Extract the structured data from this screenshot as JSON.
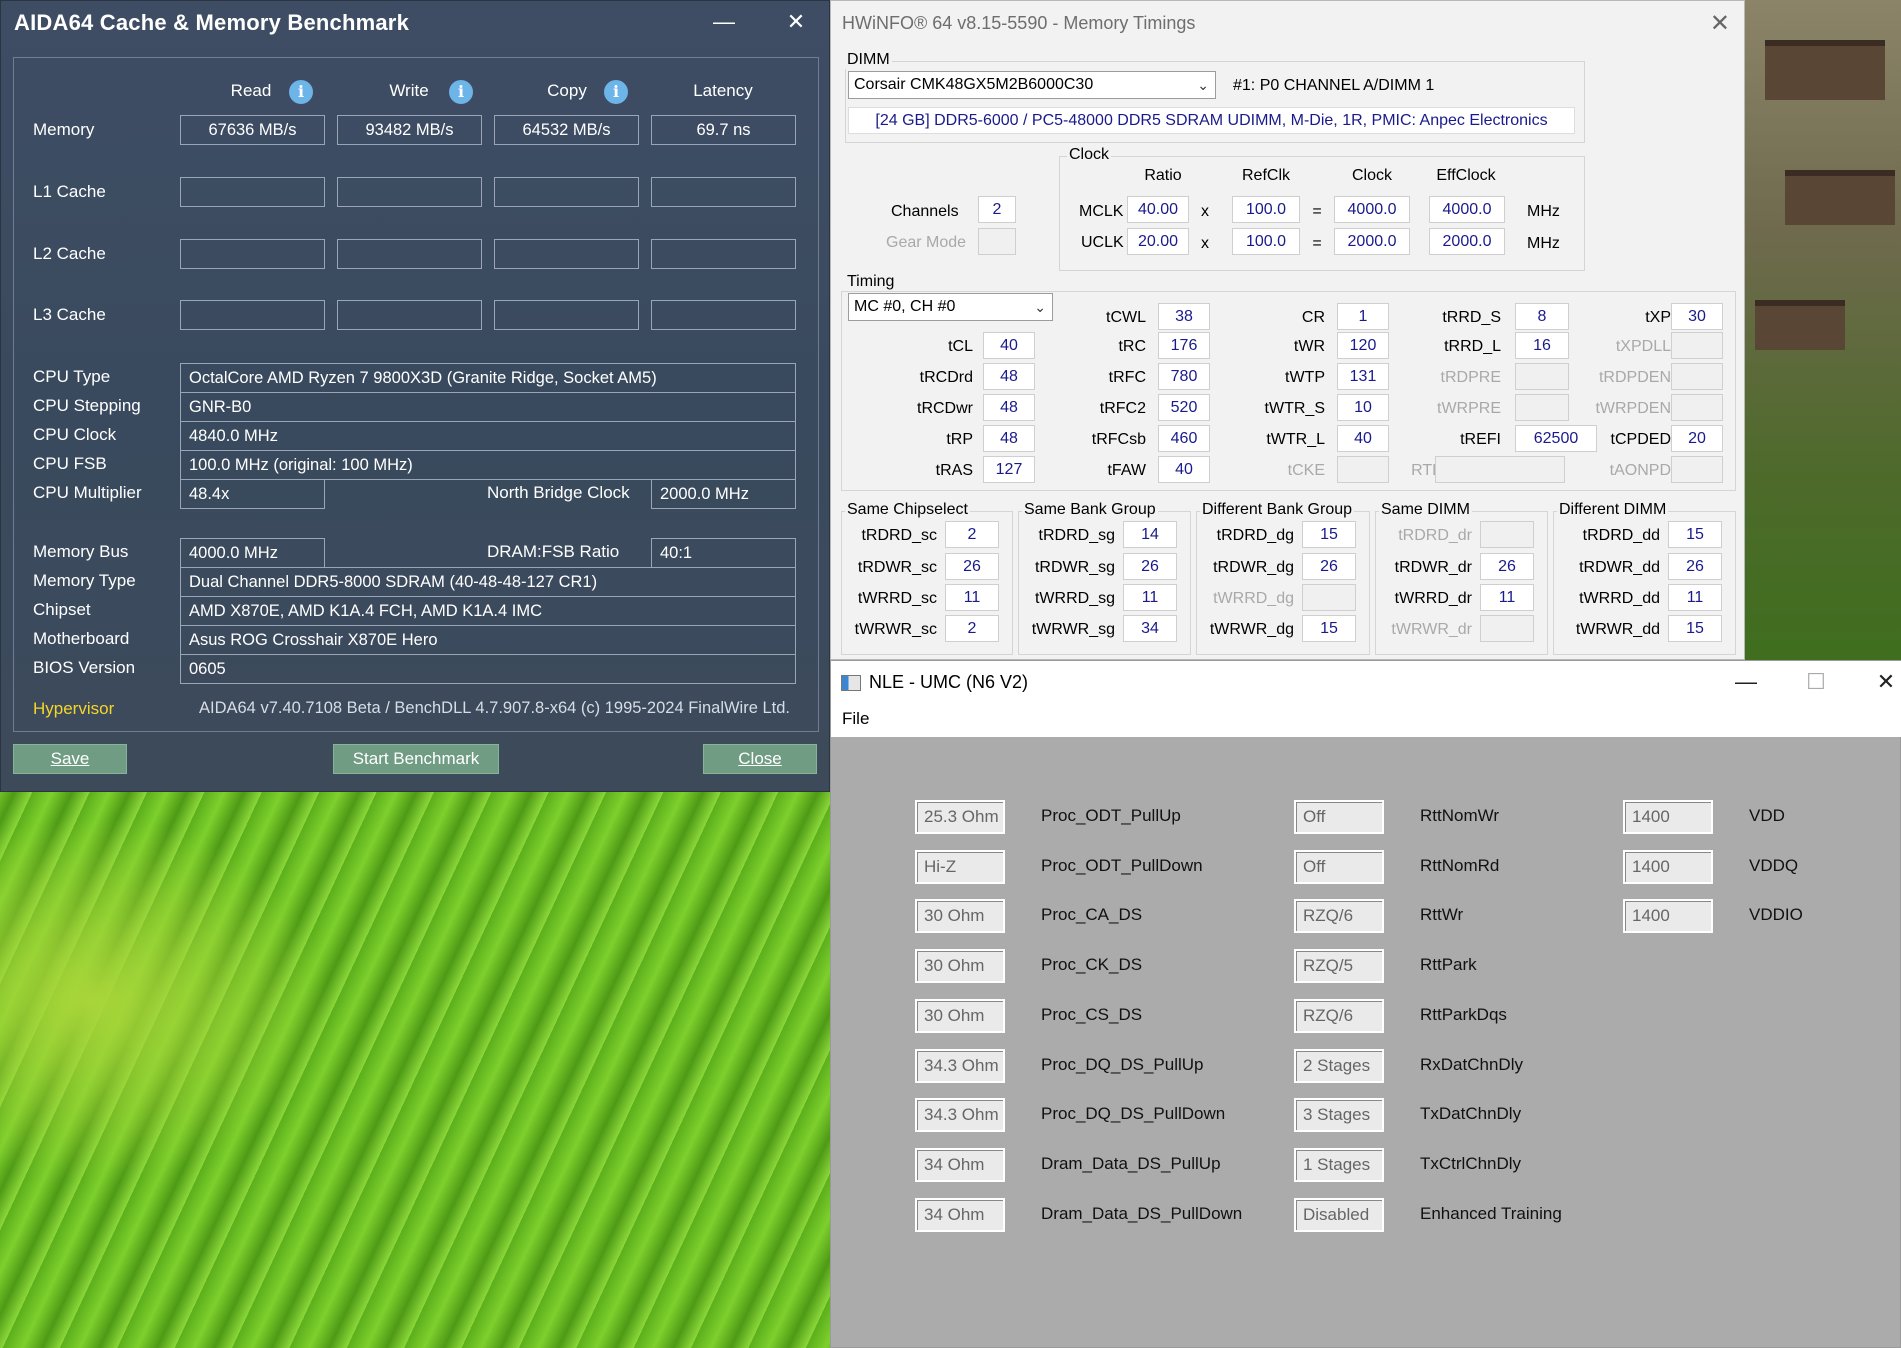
{
  "aida": {
    "title": "AIDA64 Cache & Memory Benchmark",
    "minimize": "—",
    "close_glyph": "✕",
    "headers": [
      "Read",
      "Write",
      "Copy",
      "Latency"
    ],
    "info_glyph": "i",
    "rows": [
      {
        "label": "Memory",
        "values": [
          "67636 MB/s",
          "93482 MB/s",
          "64532 MB/s",
          "69.7 ns"
        ]
      },
      {
        "label": "L1 Cache",
        "values": [
          "",
          "",
          "",
          ""
        ]
      },
      {
        "label": "L2 Cache",
        "values": [
          "",
          "",
          "",
          ""
        ]
      },
      {
        "label": "L3 Cache",
        "values": [
          "",
          "",
          "",
          ""
        ]
      }
    ],
    "cpu_type_label": "CPU Type",
    "cpu_type": "OctalCore AMD Ryzen 7 9800X3D  (Granite Ridge, Socket AM5)",
    "cpu_stepping_label": "CPU Stepping",
    "cpu_stepping": "GNR-B0",
    "cpu_clock_label": "CPU Clock",
    "cpu_clock": "4840.0 MHz",
    "cpu_fsb_label": "CPU FSB",
    "cpu_fsb": "100.0 MHz  (original: 100 MHz)",
    "cpu_multiplier_label": "CPU Multiplier",
    "cpu_multiplier": "48.4x",
    "nb_clock_label": "North Bridge Clock",
    "nb_clock": "2000.0 MHz",
    "memory_bus_label": "Memory Bus",
    "memory_bus": "4000.0 MHz",
    "dram_fsb_label": "DRAM:FSB Ratio",
    "dram_fsb": "40:1",
    "memory_type_label": "Memory Type",
    "memory_type": "Dual Channel DDR5-8000 SDRAM  (40-48-48-127 CR1)",
    "chipset_label": "Chipset",
    "chipset": "AMD X870E, AMD K1A.4 FCH, AMD K1A.4 IMC",
    "motherboard_label": "Motherboard",
    "motherboard": "Asus ROG Crosshair X870E Hero",
    "bios_label": "BIOS Version",
    "bios": "0605",
    "hypervisor": "Hypervisor",
    "footer": "AIDA64 v7.40.7108 Beta / BenchDLL 4.7.907.8-x64  (c) 1995-2024 FinalWire Ltd.",
    "save": "Save",
    "start": "Start Benchmark",
    "close": "Close"
  },
  "hwinfo": {
    "title": "HWiNFO® 64 v8.15-5590 - Memory Timings",
    "close_glyph": "✕",
    "dimm_group": "DIMM",
    "dimm_select": "Corsair CMK48GX5M2B6000C30",
    "dimm_slot": "#1: P0 CHANNEL A/DIMM 1",
    "dimm_desc": "[24 GB] DDR5-6000 / PC5-48000 DDR5 SDRAM UDIMM, M-Die, 1R, PMIC: Anpec Electronics",
    "clock_group": "Clock",
    "clock_headers": [
      "Ratio",
      "RefClk",
      "Clock",
      "EffClock"
    ],
    "channels_label": "Channels",
    "channels": "2",
    "gear_label": "Gear Mode",
    "gear": "",
    "mclk": {
      "label": "MCLK",
      "ratio": "40.00",
      "refclk": "100.0",
      "clock": "4000.0",
      "eff": "4000.0"
    },
    "uclk": {
      "label": "UCLK",
      "ratio": "20.00",
      "refclk": "100.0",
      "clock": "2000.0",
      "eff": "2000.0"
    },
    "op_x": "x",
    "op_eq": "=",
    "unit": "MHz",
    "timing_group": "Timing",
    "timing_select": "MC #0, CH #0",
    "timings": {
      "tCL": "40",
      "tRCDrd": "48",
      "tRCDwr": "48",
      "tRP": "48",
      "tRAS": "127",
      "tCWL": "38",
      "tRC": "176",
      "tRFC": "780",
      "tRFC2": "520",
      "tRFCsb": "460",
      "tFAW": "40",
      "CR": "1",
      "tWR": "120",
      "tWTP": "131",
      "tWTR_S": "10",
      "tWTR_L": "40",
      "tCKE": "",
      "tRRD_S": "8",
      "tRRD_L": "16",
      "tRDPRE": "",
      "tWRPRE": "",
      "tREFI": "62500",
      "RTL": "",
      "tXP": "30",
      "tXPDLL": "",
      "tRDPDEN": "",
      "tWRPDEN": "",
      "tCPDED": "20",
      "tAONPD": ""
    },
    "groups": [
      {
        "title": "Same Chipselect",
        "rows": [
          [
            "tRDRD_sc",
            "2",
            false
          ],
          [
            "tRDWR_sc",
            "26",
            false
          ],
          [
            "tWRRD_sc",
            "11",
            false
          ],
          [
            "tWRWR_sc",
            "2",
            false
          ]
        ]
      },
      {
        "title": "Same Bank Group",
        "rows": [
          [
            "tRDRD_sg",
            "14",
            false
          ],
          [
            "tRDWR_sg",
            "26",
            false
          ],
          [
            "tWRRD_sg",
            "11",
            false
          ],
          [
            "tWRWR_sg",
            "34",
            false
          ]
        ]
      },
      {
        "title": "Different Bank Group",
        "rows": [
          [
            "tRDRD_dg",
            "15",
            false
          ],
          [
            "tRDWR_dg",
            "26",
            false
          ],
          [
            "tWRRD_dg",
            "",
            true
          ],
          [
            "tWRWR_dg",
            "15",
            false
          ]
        ]
      },
      {
        "title": "Same DIMM",
        "rows": [
          [
            "tRDRD_dr",
            "",
            true
          ],
          [
            "tRDWR_dr",
            "26",
            false
          ],
          [
            "tWRRD_dr",
            "11",
            false
          ],
          [
            "tWRWR_dr",
            "",
            true
          ]
        ]
      },
      {
        "title": "Different DIMM",
        "rows": [
          [
            "tRDRD_dd",
            "15",
            false
          ],
          [
            "tRDWR_dd",
            "26",
            false
          ],
          [
            "tWRRD_dd",
            "11",
            false
          ],
          [
            "tWRWR_dd",
            "15",
            false
          ]
        ]
      }
    ]
  },
  "nle": {
    "title": "NLE - UMC (N6 V2)",
    "menu_file": "File",
    "minimize": "—",
    "maximize": "☐",
    "close_glyph": "✕",
    "col1": [
      [
        "25.3 Ohm",
        "Proc_ODT_PullUp"
      ],
      [
        "Hi-Z",
        "Proc_ODT_PullDown"
      ],
      [
        "30 Ohm",
        "Proc_CA_DS"
      ],
      [
        "30 Ohm",
        "Proc_CK_DS"
      ],
      [
        "30 Ohm",
        "Proc_CS_DS"
      ],
      [
        "34.3 Ohm",
        "Proc_DQ_DS_PullUp"
      ],
      [
        "34.3 Ohm",
        "Proc_DQ_DS_PullDown"
      ],
      [
        "34 Ohm",
        "Dram_Data_DS_PullUp"
      ],
      [
        "34 Ohm",
        "Dram_Data_DS_PullDown"
      ]
    ],
    "col2": [
      [
        "Off",
        "RttNomWr"
      ],
      [
        "Off",
        "RttNomRd"
      ],
      [
        "RZQ/6",
        "RttWr"
      ],
      [
        "RZQ/5",
        "RttPark"
      ],
      [
        "RZQ/6",
        "RttParkDqs"
      ],
      [
        "2 Stages",
        "RxDatChnDly"
      ],
      [
        "3 Stages",
        "TxDatChnDly"
      ],
      [
        "1 Stages",
        "TxCtrlChnDly"
      ],
      [
        "Disabled",
        "Enhanced Training"
      ]
    ],
    "col3": [
      [
        "1400",
        "VDD"
      ],
      [
        "1400",
        "VDDQ"
      ],
      [
        "1400",
        "VDDIO"
      ]
    ]
  }
}
